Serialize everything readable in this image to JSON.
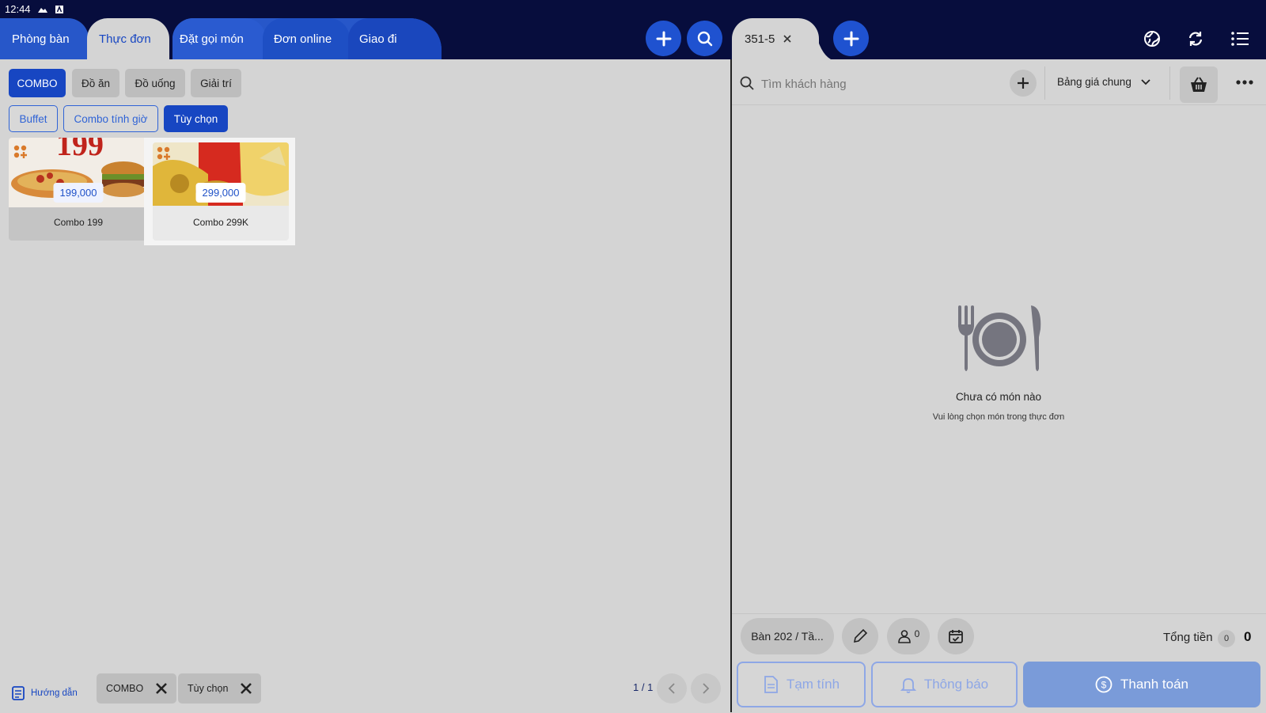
{
  "status_bar": {
    "time": "12:44"
  },
  "nav_tabs": [
    {
      "label": "Phòng bàn"
    },
    {
      "label": "Thực đơn"
    },
    {
      "label": "Đặt gọi món"
    },
    {
      "label": "Đơn online"
    },
    {
      "label": "Giao đi"
    }
  ],
  "order_tab": {
    "label": "351-5"
  },
  "categories": [
    {
      "label": "COMBO"
    },
    {
      "label": "Đồ ăn"
    },
    {
      "label": "Đồ uống"
    },
    {
      "label": "Giải trí"
    }
  ],
  "sub_categories": [
    {
      "label": "Buffet"
    },
    {
      "label": "Combo tính giờ"
    },
    {
      "label": "Tùy chọn"
    }
  ],
  "products": [
    {
      "name": "Combo 199",
      "price": "199,000",
      "image_text": "199"
    },
    {
      "name": "Combo 299K",
      "price": "299,000"
    }
  ],
  "customer_search": {
    "placeholder": "Tìm khách hàng"
  },
  "price_list": {
    "label": "Bảng giá chung"
  },
  "empty_state": {
    "title": "Chưa có món nào",
    "subtitle": "Vui lòng chọn món trong thực đơn"
  },
  "order_info": {
    "table": "Bàn 202 / Tầ...",
    "guests": "0",
    "total_label": "Tổng tiền",
    "total_qty": "0",
    "total_value": "0"
  },
  "actions": {
    "draft": "Tạm tính",
    "notify": "Thông báo",
    "pay": "Thanh toán"
  },
  "footer": {
    "guide": "Hướng dẫn",
    "filters": [
      {
        "label": "COMBO"
      },
      {
        "label": "Tùy chọn"
      }
    ],
    "pagination": "1 / 1"
  },
  "colors": {
    "header_bg": "#070d3d",
    "accent": "#1746c2",
    "panel_bg": "#d4d4d4"
  }
}
